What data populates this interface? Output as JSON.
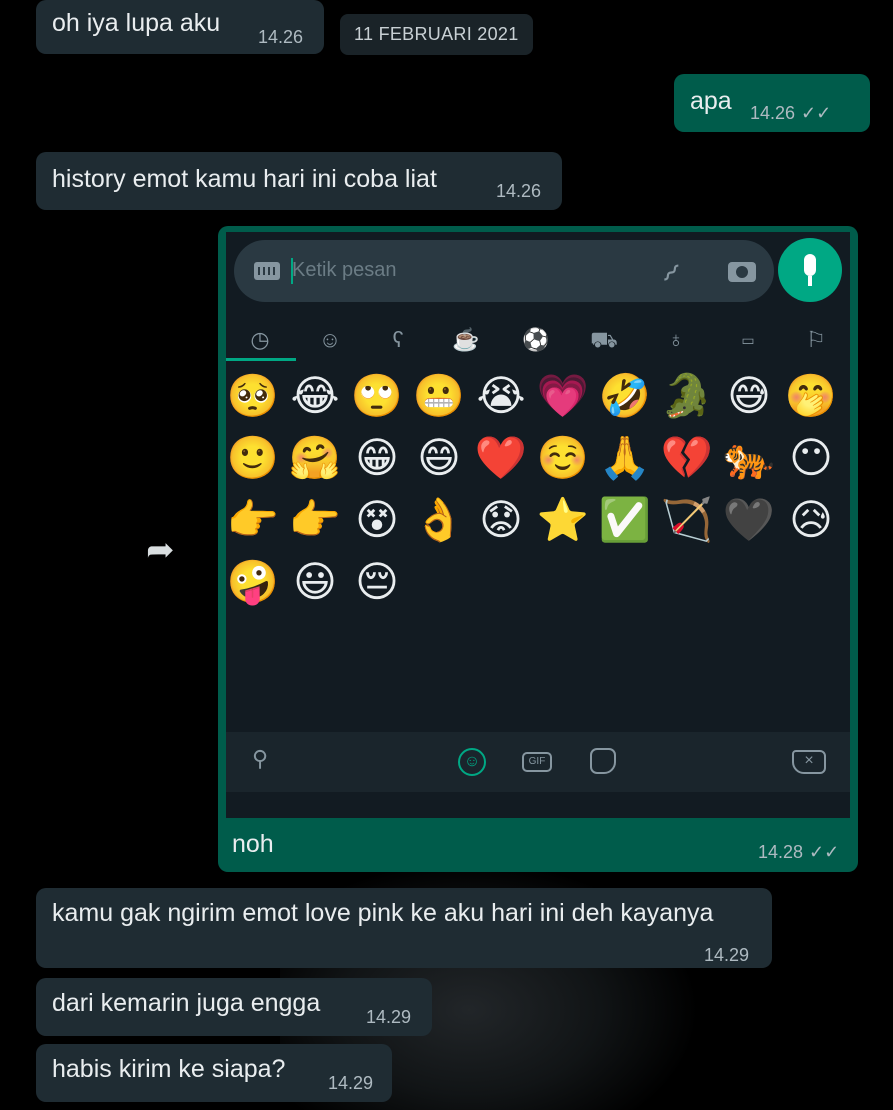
{
  "messages": {
    "m1": {
      "text": "oh iya lupa aku",
      "time": "14.26"
    },
    "date_separator": "11 FEBRUARI 2021",
    "m2": {
      "text": "apa",
      "time": "14.26"
    },
    "m3": {
      "text": "history emot kamu hari ini coba liat",
      "time": "14.26"
    },
    "m4": {
      "caption": "noh",
      "time": "14.28"
    },
    "m5": {
      "text": "kamu gak ngirim emot love pink ke aku hari ini deh kayanya",
      "time": "14.29"
    },
    "m6": {
      "text": "dari kemarin juga engga",
      "time": "14.29"
    },
    "m7": {
      "text": "habis kirim ke siapa?",
      "time": "14.29"
    }
  },
  "screenshot": {
    "placeholder": "Ketik pesan",
    "categories": [
      "recent-icon",
      "smiley-icon",
      "animal-icon",
      "food-icon",
      "activity-icon",
      "travel-icon",
      "objects-icon",
      "symbols-icon",
      "flags-icon"
    ],
    "recent_emojis": [
      [
        "🥺",
        "😂",
        "🙄",
        "😬",
        "😭",
        "💗",
        "🤣",
        "🐊",
        "😅",
        "🤭"
      ],
      [
        "🙂",
        "🤗",
        "😁",
        "😄",
        "❤️",
        "☺️",
        "🙏",
        "💔",
        "🐅",
        "😶"
      ],
      [
        "👉",
        "👉",
        "😵",
        "👌",
        "😟",
        "⭐",
        "✅",
        "🏹",
        "🖤",
        "😥"
      ],
      [
        "🤪",
        "😃",
        "😔"
      ]
    ],
    "bottom_bar": {
      "gif_label": "GIF"
    }
  },
  "colors": {
    "incoming_bubble": "#1f2c33",
    "outgoing_bubble": "#005c4b",
    "accent": "#00a884",
    "read_ticks": "#aebac1"
  }
}
